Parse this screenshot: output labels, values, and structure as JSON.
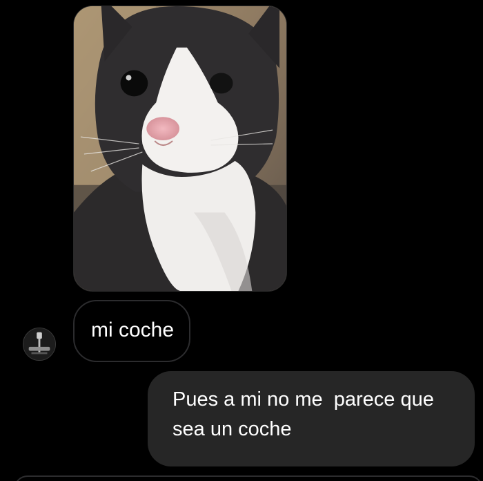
{
  "messages": {
    "received_photo": {
      "alt": "cat-photo"
    },
    "received_text": "mi coche",
    "sent_text": "Pues a mi no me  parece que sea un coche"
  },
  "colors": {
    "background": "#000000",
    "sent_bubble": "#262626",
    "received_border": "#2c2c2e",
    "text": "#ffffff"
  },
  "icons": {
    "avatar": "contact-avatar"
  }
}
